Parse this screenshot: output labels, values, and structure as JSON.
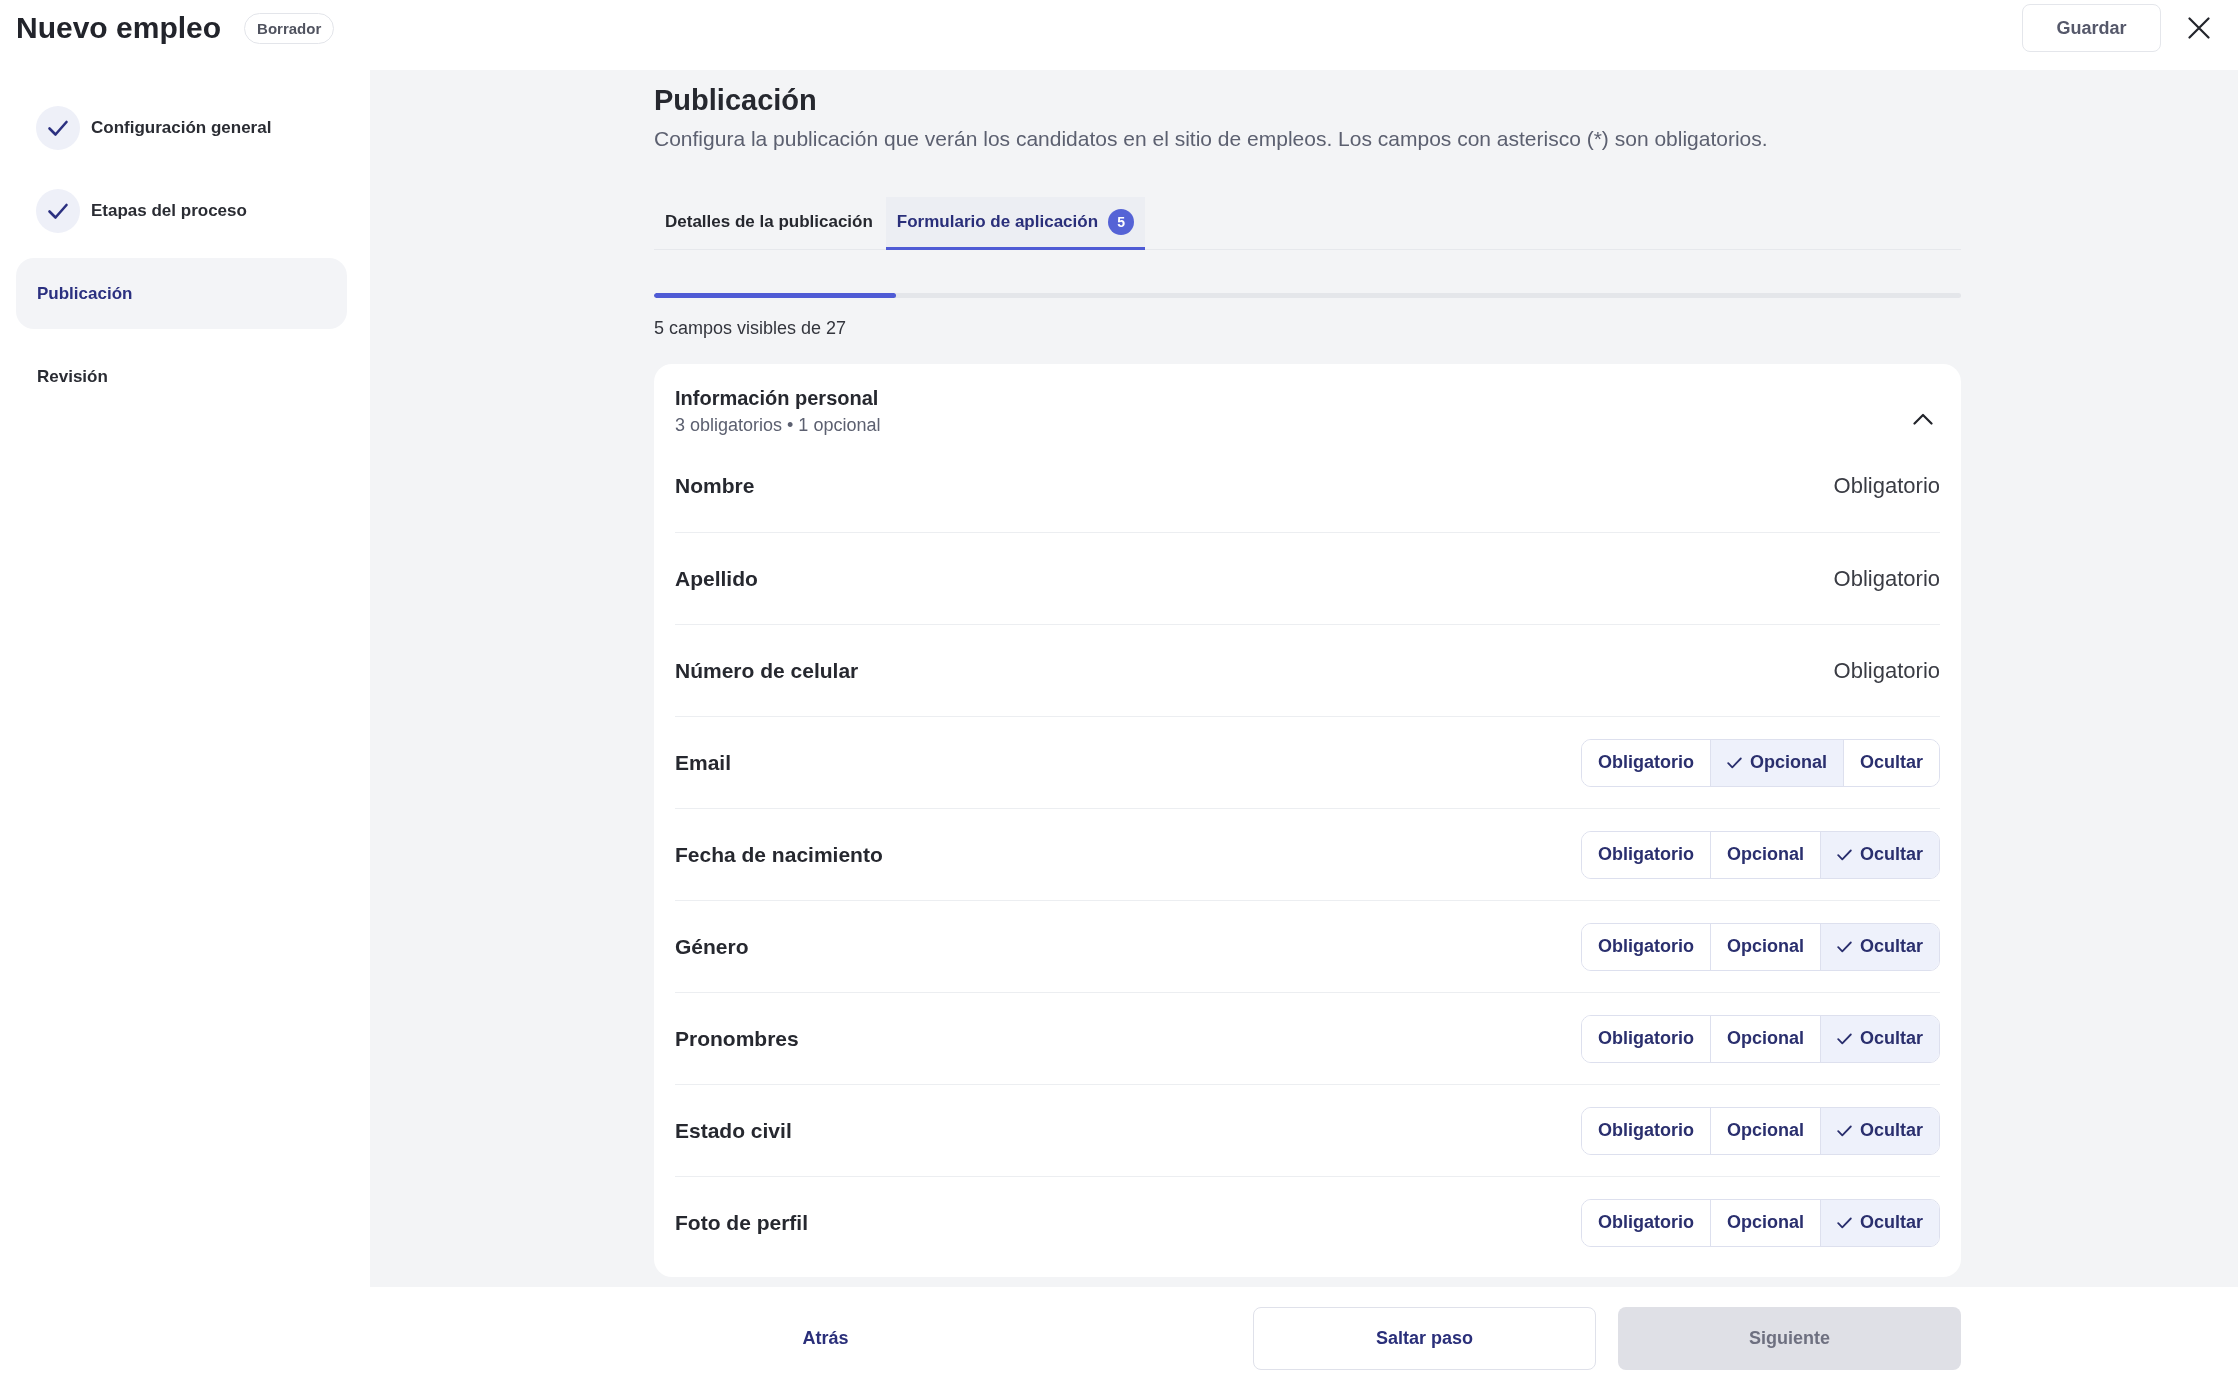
{
  "header": {
    "title": "Nuevo empleo",
    "status": "Borrador",
    "save_button": "Guardar"
  },
  "sidebar": {
    "items": [
      {
        "label": "Configuración general",
        "completed": true,
        "selected": false
      },
      {
        "label": "Etapas del proceso",
        "completed": true,
        "selected": false
      },
      {
        "label": "Publicación",
        "completed": false,
        "selected": true
      },
      {
        "label": "Revisión",
        "completed": false,
        "selected": false
      }
    ]
  },
  "page": {
    "title": "Publicación",
    "description": "Configura la publicación que verán los candidatos en el sitio de empleos. Los campos con asterisco (*) son obligatorios."
  },
  "tabs": [
    {
      "label": "Detalles de la publicación",
      "selected": false
    },
    {
      "label": "Formulario de aplicación",
      "selected": true,
      "count": "5"
    }
  ],
  "progress": {
    "level": 0.185,
    "caption": "5 campos visibles de 27"
  },
  "section": {
    "title": "Información personal",
    "summary": "3 obligatorios • 1 opcional",
    "expanded": true,
    "fields": [
      {
        "label": "Nombre",
        "kind": "fixed",
        "value": "Obligatorio"
      },
      {
        "label": "Apellido",
        "kind": "fixed",
        "value": "Obligatorio"
      },
      {
        "label": "Número de celular",
        "kind": "fixed",
        "value": "Obligatorio"
      },
      {
        "label": "Email",
        "kind": "choice",
        "options": [
          {
            "label": "Obligatorio",
            "selected": false
          },
          {
            "label": "Opcional",
            "selected": true
          },
          {
            "label": "Ocultar",
            "selected": false
          }
        ]
      },
      {
        "label": "Fecha de nacimiento",
        "kind": "choice",
        "options": [
          {
            "label": "Obligatorio",
            "selected": false
          },
          {
            "label": "Opcional",
            "selected": false
          },
          {
            "label": "Ocultar",
            "selected": true
          }
        ]
      },
      {
        "label": "Género",
        "kind": "choice",
        "options": [
          {
            "label": "Obligatorio",
            "selected": false
          },
          {
            "label": "Opcional",
            "selected": false
          },
          {
            "label": "Ocultar",
            "selected": true
          }
        ]
      },
      {
        "label": "Pronombres",
        "kind": "choice",
        "options": [
          {
            "label": "Obligatorio",
            "selected": false
          },
          {
            "label": "Opcional",
            "selected": false
          },
          {
            "label": "Ocultar",
            "selected": true
          }
        ]
      },
      {
        "label": "Estado civil",
        "kind": "choice",
        "options": [
          {
            "label": "Obligatorio",
            "selected": false
          },
          {
            "label": "Opcional",
            "selected": false
          },
          {
            "label": "Ocultar",
            "selected": true
          }
        ]
      },
      {
        "label": "Foto de perfil",
        "kind": "choice",
        "options": [
          {
            "label": "Obligatorio",
            "selected": false
          },
          {
            "label": "Opcional",
            "selected": false
          },
          {
            "label": "Ocultar",
            "selected": true
          }
        ]
      }
    ]
  },
  "footer": {
    "back_button": "Atrás",
    "skip_button": "Saltar paso",
    "next_button": {
      "label": "Siguiente",
      "disabled": true
    }
  }
}
